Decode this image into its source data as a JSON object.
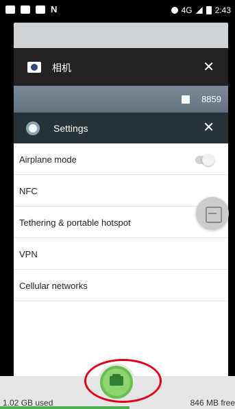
{
  "status_bar": {
    "network": "4G",
    "time": "2:43"
  },
  "recents": {
    "camera_card": {
      "title": "相机",
      "strip_number": "8859"
    },
    "settings_card": {
      "title": "Settings",
      "items": [
        {
          "label": "Airplane mode"
        },
        {
          "label": "NFC"
        },
        {
          "label": "Tethering & portable hotspot"
        },
        {
          "label": "VPN"
        },
        {
          "label": "Cellular networks"
        }
      ]
    }
  },
  "memory": {
    "used": "1.02 GB used",
    "free": "846 MB free",
    "used_fraction": 0.55
  },
  "colors": {
    "accent_green": "#4caf50",
    "annotation_red": "#e0001a"
  }
}
